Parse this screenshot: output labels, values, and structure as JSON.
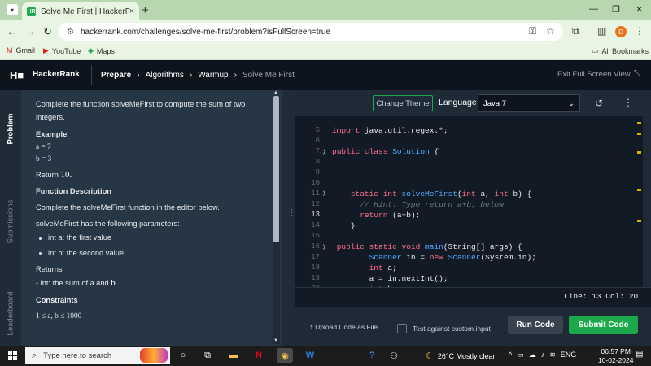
{
  "browser": {
    "tab_title": "Solve Me First | HackerRank",
    "tab_favicon": "HR",
    "url": "hackerrank.com/challenges/solve-me-first/problem?isFullScreen=true",
    "profile_initial": "D",
    "bookmarks": [
      "Gmail",
      "YouTube",
      "Maps"
    ],
    "all_bookmarks": "All Bookmarks"
  },
  "header": {
    "logo": "H■",
    "brand": "HackerRank",
    "breadcrumbs": [
      "Prepare",
      "Algorithms",
      "Warmup"
    ],
    "current": "Solve Me First",
    "exit_fullscreen": "Exit Full Screen View"
  },
  "side_tabs": [
    "Problem",
    "Submissions",
    "Leaderboard"
  ],
  "problem": {
    "intro": "Complete the function solveMeFirst to compute the sum of two",
    "intro2": "integers.",
    "example_heading": "Example",
    "example_a": "a = 7",
    "example_b": "b = 3",
    "return_text": "Return",
    "return_value": "10.",
    "func_desc_heading": "Function Description",
    "func_desc": "Complete the solveMeFirst function in the editor below.",
    "params_intro": "solveMeFirst has the following parameters:",
    "params": [
      "int a: the first value",
      "int b: the second value"
    ],
    "returns_heading": "Returns",
    "returns_text": "- int: the sum of",
    "returns_a": "a",
    "returns_and": "and",
    "returns_b": "b",
    "constraints_heading": "Constraints",
    "constraint": "1 ≤ a, b ≤ 1000"
  },
  "editor": {
    "theme_button": "Change Theme",
    "language_label": "Language",
    "language": "Java 7",
    "line_numbers": [
      "5",
      "6",
      "7",
      "8",
      "9",
      "10",
      "11",
      "12",
      "13",
      "14",
      "15",
      "16",
      "17",
      "18",
      "19",
      "20"
    ],
    "current_line": "13",
    "status": "Line: 13 Col: 20"
  },
  "actions": {
    "upload": "Upload Code as File",
    "custom_input": "Test against custom input",
    "run": "Run Code",
    "submit": "Submit Code"
  },
  "taskbar": {
    "search_placeholder": "Type here to search",
    "weather": "26°C  Mostly clear",
    "lang": "ENG",
    "time": "06:57 PM",
    "date": "10-02-2024"
  },
  "colors": {
    "accent_green": "#1ba94c",
    "hr_dark": "#0e141e",
    "panel": "#263645",
    "keyword": "#ff6f8a",
    "type": "#52a8ff"
  }
}
